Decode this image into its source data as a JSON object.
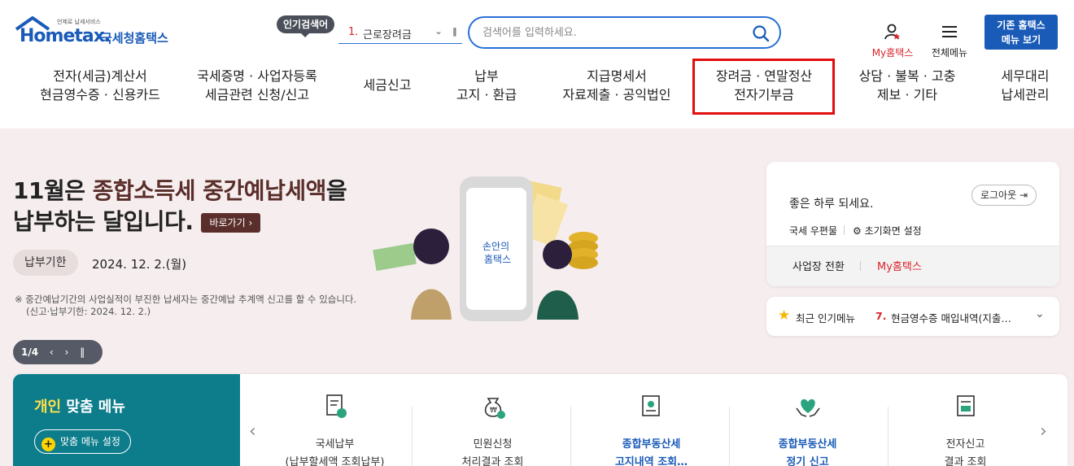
{
  "header": {
    "logo_sub": "언제로 납세서비스",
    "logo_brand": "Hometax.",
    "logo_name": "국세청홈택스",
    "popular_badge": "인기검색어",
    "popular_num": "1.",
    "popular_text": "근로장려금",
    "search_placeholder": "검색어를 입력하세요.",
    "my_hometax": "My홈택스",
    "all_menu": "전체메뉴",
    "old_btn_line1": "기존 홈택스",
    "old_btn_line2": "메뉴 보기"
  },
  "gnb": [
    {
      "line1": "전자(세금)계산서",
      "line2": "현금영수증 · 신용카드"
    },
    {
      "line1": "국세증명 · 사업자등록",
      "line2": "세금관련 신청/신고"
    },
    {
      "line1": "세금신고",
      "line2": ""
    },
    {
      "line1": "납부",
      "line2": "고지 · 환급"
    },
    {
      "line1": "지급명세서",
      "line2": "자료제출 · 공익법인"
    },
    {
      "line1": "장려금 · 연말정산",
      "line2": "전자기부금"
    },
    {
      "line1": "상담 · 불복 · 고충",
      "line2": "제보 · 기타"
    },
    {
      "line1": "세무대리",
      "line2": "납세관리"
    }
  ],
  "hero": {
    "title_a": "11월은 ",
    "title_hl": "종합소득세 중간예납세액",
    "title_b": "을",
    "title_line2": "납부하는 달입니다.",
    "goto": "바로가기 ›",
    "due_label": "납부기한",
    "due_date": "2024. 12. 2.(월)",
    "note1": "※ 중간예납기간의 사업실적이 부진한 납세자는 중간예납 추계액 신고를 할 수 있습니다.",
    "note2": "(신고·납부기한: 2024. 12. 2.)",
    "pager_text": "1/4",
    "phone_text1": "손안의",
    "phone_text2": "홈택스"
  },
  "login": {
    "greeting": "좋은 하루 되세요.",
    "logout": "로그아웃",
    "mailbox": "국세 우편물",
    "init_setting": "초기화면 설정",
    "biz_switch": "사업장 전환",
    "my_hometax": "My홈택스"
  },
  "recent": {
    "label": "최근 인기메뉴",
    "num": "7.",
    "value": "현금영수증 매입내역(지출…"
  },
  "quick": {
    "title_hl": "개인",
    "title_rest": " 맞춤 메뉴",
    "set_label": "맞춤 메뉴 설정",
    "items": [
      {
        "line1": "국세납부",
        "line2": "(납부할세액 조회납부)"
      },
      {
        "line1": "민원신청",
        "line2": "처리결과 조회"
      },
      {
        "line1": "종합부동산세",
        "line2": "고지내역 조회…"
      },
      {
        "line1": "종합부동산세",
        "line2": "정기 신고"
      },
      {
        "line1": "전자신고",
        "line2": "결과 조회"
      }
    ]
  },
  "colors": {
    "brand_blue": "#1a5bb8",
    "accent_red": "#d9262c",
    "hero_bg": "#f6eeee",
    "teal": "#0d7d8c"
  }
}
